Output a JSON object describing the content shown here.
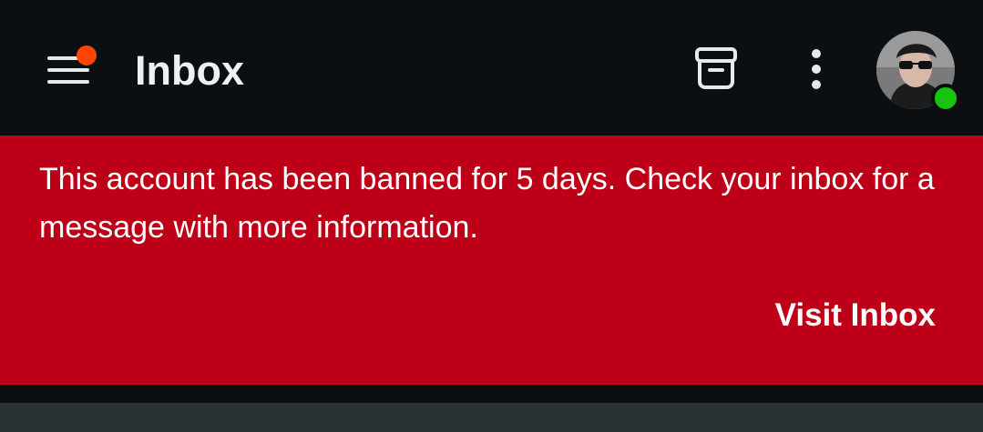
{
  "header": {
    "title": "Inbox",
    "menu_icon": "hamburger-menu-icon",
    "archive_icon": "archive-icon",
    "more_icon": "more-vertical-icon",
    "notification_color": "#ff4500",
    "online_color": "#16c40e"
  },
  "banner": {
    "message": "This account has been banned for 5 days. Check your inbox for a message with more information.",
    "action_label": "Visit Inbox",
    "background": "#bd0018"
  }
}
